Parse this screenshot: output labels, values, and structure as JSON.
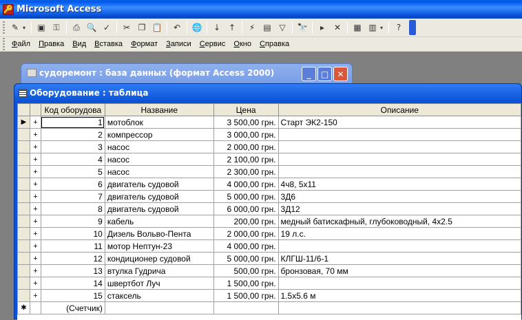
{
  "app": {
    "title": "Microsoft Access"
  },
  "toolbar": {
    "buttons": [
      "design-view",
      "save",
      "permissions",
      "print",
      "print-preview",
      "spelling",
      "cut",
      "copy",
      "paste",
      "undo",
      "hyperlink",
      "sort-asc",
      "sort-desc",
      "filter-selection",
      "filter-form",
      "apply-filter",
      "find",
      "new-record",
      "delete-record",
      "database-window",
      "new-object",
      "help"
    ]
  },
  "menu": [
    "Файл",
    "Правка",
    "Вид",
    "Вставка",
    "Формат",
    "Записи",
    "Сервис",
    "Окно",
    "Справка"
  ],
  "db_window": {
    "title": "судоремонт : база данных (формат Access 2000)"
  },
  "table_window": {
    "title": "Оборудование : таблица"
  },
  "table": {
    "columns": [
      "Код оборудова",
      "Название",
      "Цена",
      "Описание"
    ],
    "rows": [
      [
        "1",
        "мотоблок",
        "3 500,00 грн.",
        "Старт ЭК2-150"
      ],
      [
        "2",
        "компрессор",
        "3 000,00 грн.",
        ""
      ],
      [
        "3",
        "насос",
        "2 000,00 грн.",
        ""
      ],
      [
        "4",
        "насос",
        "2 100,00 грн.",
        ""
      ],
      [
        "5",
        "насос",
        "2 300,00 грн.",
        ""
      ],
      [
        "6",
        "двигатель судовой",
        "4 000,00 грн.",
        "4ч8, 5х11"
      ],
      [
        "7",
        "двигатель судовой",
        "5 000,00 грн.",
        "3Д6"
      ],
      [
        "8",
        "двигатель судовой",
        "6 000,00 грн.",
        "3Д12"
      ],
      [
        "9",
        "кабель",
        "200,00 грн.",
        "медный батискафный, глубоководный, 4х2.5"
      ],
      [
        "10",
        "Дизель Вольво-Пента",
        "2 000,00 грн.",
        "19 л.с."
      ],
      [
        "11",
        "мотор Нептун-23",
        "4 000,00 грн.",
        ""
      ],
      [
        "12",
        "кондиционер судовой",
        "5 000,00 грн.",
        "КЛГШ-11/6-1"
      ],
      [
        "13",
        "втулка Гудрича",
        "500,00 грн.",
        "бронзовая, 70 мм"
      ],
      [
        "14",
        "швертбот Луч",
        "1 500,00 грн.",
        ""
      ],
      [
        "15",
        "стаксель",
        "1 500,00 грн.",
        "1.5х5.6 м"
      ]
    ],
    "new_row_placeholder": "(Счетчик)",
    "expand_symbol": "+",
    "current_row_marker": "▶",
    "new_row_marker": "✱"
  }
}
